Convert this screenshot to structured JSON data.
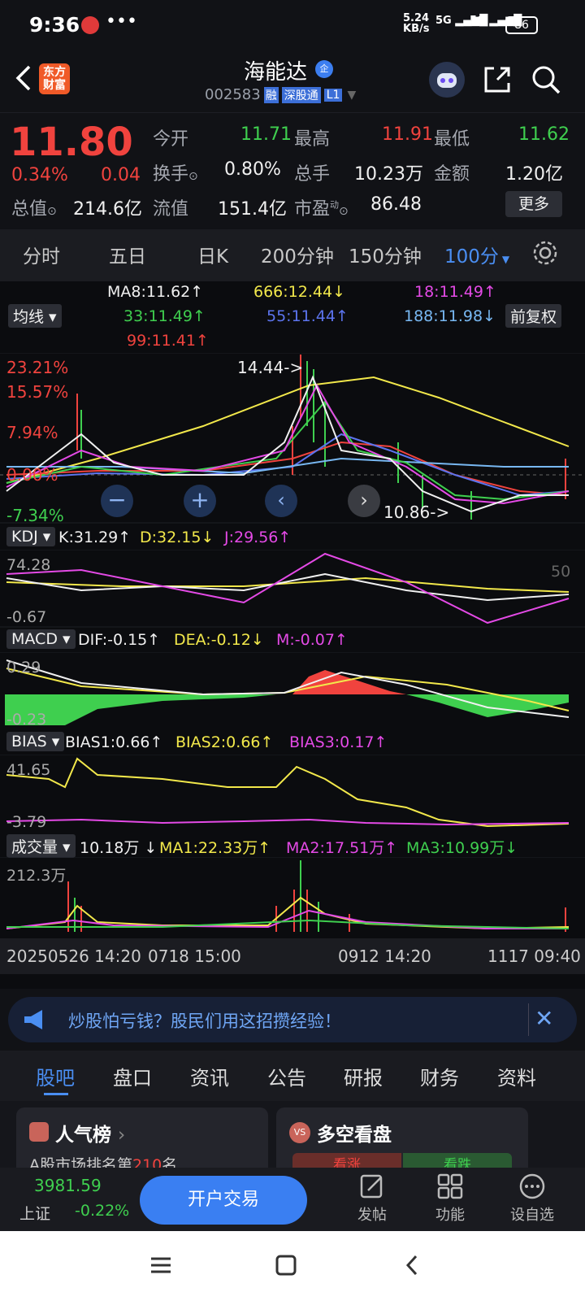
{
  "status": {
    "time": "9:36",
    "speed_top": "5.24",
    "speed_unit": "KB/s",
    "net1": "5G",
    "net2": "5G",
    "battery": "86"
  },
  "header": {
    "brand_line1": "东方",
    "brand_line2": "财富",
    "stock_name": "海能达",
    "stock_code": "002583",
    "tag_rong": "融",
    "tag_connect": "深股通",
    "tag_level": "L1"
  },
  "quote": {
    "price": "11.80",
    "change_pct": "0.34%",
    "change_abs": "0.04",
    "open_label": "今开",
    "open_val": "11.71",
    "high_label": "最高",
    "high_val": "11.91",
    "low_label": "最低",
    "low_val": "11.62",
    "turnover_label": "换手",
    "turnover_val": "0.80%",
    "volume_label": "总手",
    "volume_val": "10.23万",
    "amount_label": "金额",
    "amount_val": "1.20亿",
    "mktcap_label": "总值",
    "mktcap_val": "214.6亿",
    "float_label": "流值",
    "float_val": "151.4亿",
    "pe_label": "市盈",
    "pe_sup": "动",
    "pe_val": "86.48",
    "more_label": "更多"
  },
  "tabs": [
    "分时",
    "五日",
    "日K",
    "200分钟",
    "150分钟",
    "100分"
  ],
  "ma_legend": {
    "selector": "均线",
    "adjust": "前复权",
    "ma8": "MA8:11.62",
    "ma666": "666:12.44",
    "ma18": "18:11.49",
    "ma33": "33:11.49",
    "ma55": "55:11.44",
    "ma188": "188:11.98",
    "ma99": "99:11.41"
  },
  "main_axis": {
    "top": "23.21%",
    "second": "15.57%",
    "third": "7.94%",
    "zero": "0.00%",
    "bottom": "-7.34%",
    "high_marker": "14.44->",
    "low_marker": "10.86->"
  },
  "kdj": {
    "name": "KDJ",
    "k": "K:31.29",
    "d": "D:32.15",
    "j": "J:29.56",
    "top": "74.28",
    "bottom": "-0.67",
    "mid": "50"
  },
  "macd": {
    "name": "MACD",
    "dif": "DIF:-0.15",
    "dea": "DEA:-0.12",
    "m": "M:-0.07",
    "top": "0.29",
    "bottom": "-0.23"
  },
  "bias": {
    "name": "BIAS",
    "b1": "BIAS1:0.66",
    "b2": "BIAS2:0.66",
    "b3": "BIAS3:0.17",
    "top": "41.65",
    "bottom": "-3.79"
  },
  "volume": {
    "name": "成交量",
    "val": "10.18万",
    "ma1": "MA1:22.33万",
    "ma2": "MA2:17.51万",
    "ma3": "MA3:10.99万",
    "top": "212.3万"
  },
  "time_axis": [
    "20250526 14:20",
    "0718 15:00",
    "0912 14:20",
    "1117 09:40"
  ],
  "banner_text": "炒股怕亏钱？股民们用这招攒经验！",
  "section_tabs": [
    "股吧",
    "盘口",
    "资讯",
    "公告",
    "研报",
    "财务",
    "资料"
  ],
  "cards": {
    "popular_title": "人气榜",
    "popular_sub_pre": "A股市场排名第",
    "popular_rank": "210",
    "popular_sub_post": "名",
    "vs_title": "多空看盘",
    "vs_up": "看涨",
    "vs_down": "看跌"
  },
  "bottom": {
    "index_val": "3981.59",
    "index_name": "上证",
    "index_chg": "-0.22%",
    "open_account": "开户交易",
    "post": "发帖",
    "func": "功能",
    "watch": "设自选"
  },
  "colors": {
    "red": "#f0433e",
    "green": "#3fcf4f",
    "yellow": "#f2e84b",
    "magenta": "#e44ae6",
    "blue": "#5c74ee",
    "lightblue": "#78b8f2",
    "active_tab": "#4a8ef2"
  }
}
